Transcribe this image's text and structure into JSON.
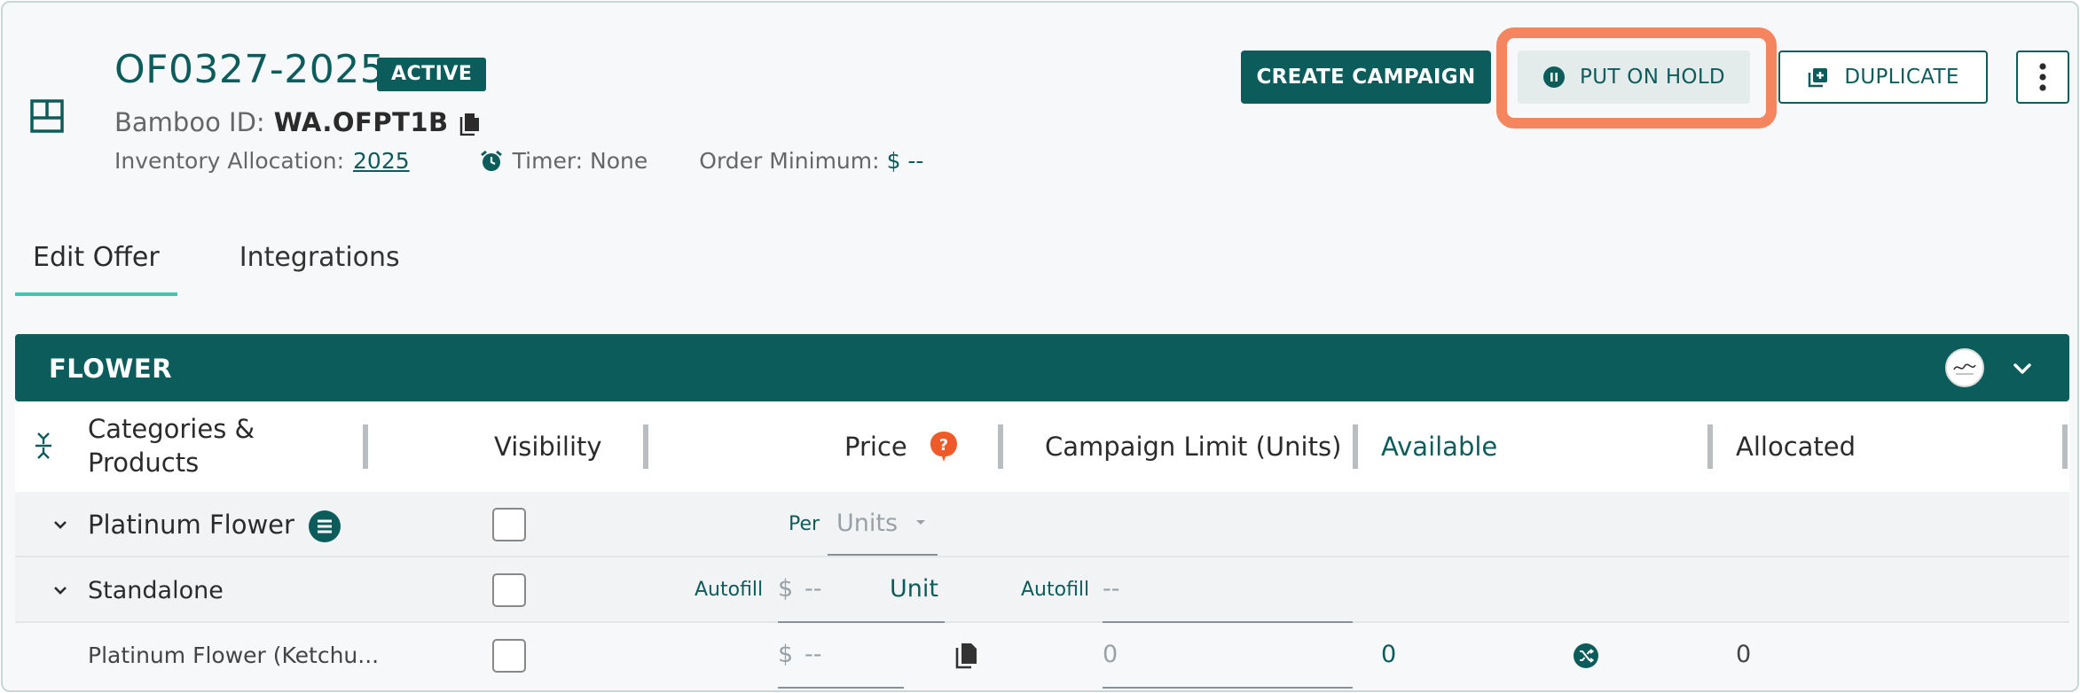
{
  "offer": {
    "title": "OF0327-2025",
    "status": "ACTIVE",
    "bamboo_label": "Bamboo ID:",
    "bamboo_id": "WA.OFPT1B",
    "inventory_label": "Inventory Allocation:",
    "inventory_value": "2025",
    "timer_text": "Timer: None",
    "order_min_label": "Order Minimum:",
    "order_min_value": "$ --"
  },
  "actions": {
    "create_campaign": "CREATE CAMPAIGN",
    "put_on_hold": "PUT ON HOLD",
    "duplicate": "DUPLICATE"
  },
  "tabs": [
    {
      "label": "Edit Offer",
      "active": true
    },
    {
      "label": "Integrations",
      "active": false
    }
  ],
  "section": {
    "title": "FLOWER"
  },
  "table": {
    "headers": {
      "categories": "Categories &",
      "categories2": "Products",
      "visibility": "Visibility",
      "price": "Price",
      "campaign_limit": "Campaign Limit (Units)",
      "available": "Available",
      "allocated": "Allocated"
    },
    "rows": [
      {
        "name": "Platinum Flower",
        "per_label": "Per",
        "unit_select": "Units"
      },
      {
        "name": "Standalone",
        "autofill1": "Autofill",
        "dollar": "$",
        "price_placeholder": "--",
        "unit_label": "Unit",
        "autofill2": "Autofill",
        "limit_placeholder": "--"
      },
      {
        "name": "Platinum Flower (Ketchu...",
        "dollar": "$",
        "price_placeholder": "--",
        "limit_placeholder": "0",
        "available": "0",
        "allocated": "0"
      }
    ]
  },
  "colors": {
    "brand": "#0d5c5c",
    "highlight": "#f4855e",
    "tab_underline": "#3cc6b6",
    "help": "#f05a28"
  }
}
